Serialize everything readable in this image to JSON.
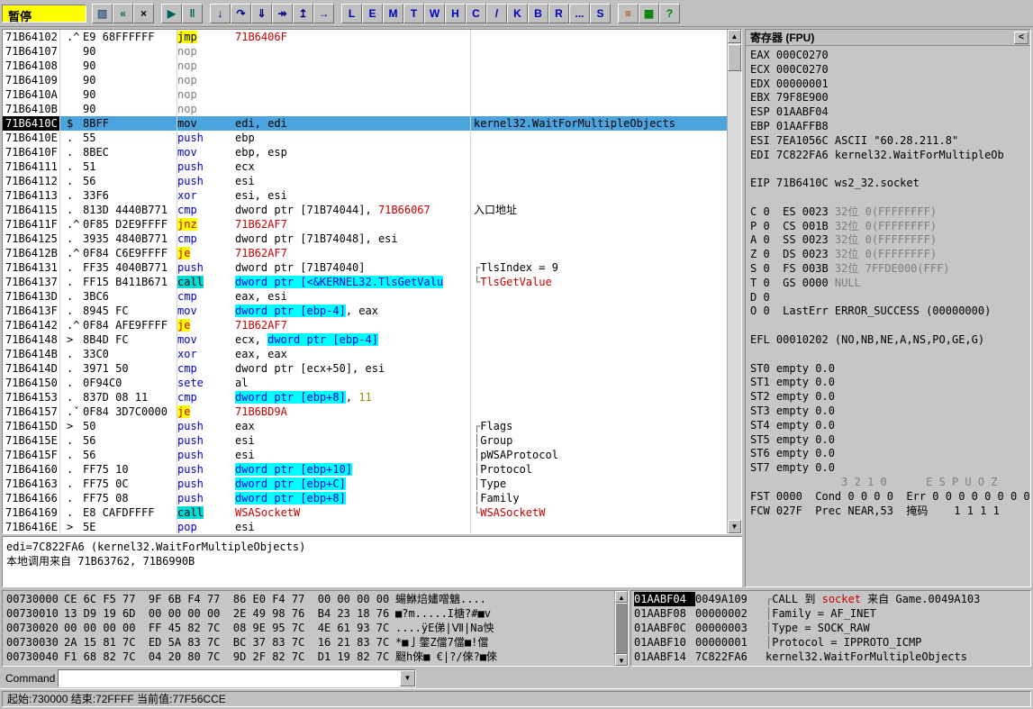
{
  "toolbar": {
    "status": "暂停",
    "groups": [
      [
        {
          "name": "open-file-button",
          "glyph": "▨",
          "color": "#406080"
        },
        {
          "name": "restart-button",
          "glyph": "«",
          "color": "#006060"
        },
        {
          "name": "close-program-button",
          "glyph": "×",
          "color": "#000000"
        }
      ],
      [
        {
          "name": "run-button",
          "glyph": "▶",
          "color": "#006060"
        },
        {
          "name": "pause-button",
          "glyph": "‖",
          "color": "#006060"
        }
      ],
      [
        {
          "name": "step-into-button",
          "glyph": "↓",
          "color": "#000080"
        },
        {
          "name": "step-over-button",
          "glyph": "↷",
          "color": "#000080"
        },
        {
          "name": "animate-into-button",
          "glyph": "⇓",
          "color": "#000080"
        },
        {
          "name": "animate-over-button",
          "glyph": "↠",
          "color": "#000080"
        },
        {
          "name": "execute-till-return-button",
          "glyph": "↥",
          "color": "#000080"
        },
        {
          "name": "goto-address-button",
          "glyph": "→",
          "color": "#000080"
        }
      ],
      [
        {
          "name": "log-window-button",
          "glyph": "L",
          "color": "#0000C0"
        },
        {
          "name": "executables-window-button",
          "glyph": "E",
          "color": "#0000C0"
        },
        {
          "name": "memory-window-button",
          "glyph": "M",
          "color": "#0000C0"
        },
        {
          "name": "threads-window-button",
          "glyph": "T",
          "color": "#0000C0"
        },
        {
          "name": "windows-window-button",
          "glyph": "W",
          "color": "#0000C0"
        },
        {
          "name": "handles-window-button",
          "glyph": "H",
          "color": "#0000C0"
        },
        {
          "name": "cpu-window-button",
          "glyph": "C",
          "color": "#0000C0"
        },
        {
          "name": "patches-window-button",
          "glyph": "/",
          "color": "#0000C0"
        },
        {
          "name": "call-stack-window-button",
          "glyph": "K",
          "color": "#0000C0"
        },
        {
          "name": "breakpoints-window-button",
          "glyph": "B",
          "color": "#0000C0"
        },
        {
          "name": "references-window-button",
          "glyph": "R",
          "color": "#0000C0"
        },
        {
          "name": "run-trace-window-button",
          "glyph": "...",
          "color": "#0000C0"
        },
        {
          "name": "source-window-button",
          "glyph": "S",
          "color": "#0000C0"
        }
      ],
      [
        {
          "name": "options-button",
          "glyph": "≡",
          "color": "#A04000"
        },
        {
          "name": "appearance-button",
          "glyph": "▦",
          "color": "#008000"
        },
        {
          "name": "help-button",
          "glyph": "?",
          "color": "#008000"
        }
      ]
    ]
  },
  "disasm": {
    "rows": [
      {
        "addr": "71B64102",
        "mark": ".^",
        "hex": "E9 68FFFFFF",
        "mn": [
          "jmp",
          "j"
        ],
        "ops": [
          [
            "71B6406F",
            "a"
          ]
        ],
        "cmt": []
      },
      {
        "addr": "71B64107",
        "mark": "",
        "hex": "90",
        "mn": [
          "nop",
          "g"
        ],
        "ops": [],
        "cmt": []
      },
      {
        "addr": "71B64108",
        "mark": "",
        "hex": "90",
        "mn": [
          "nop",
          "g"
        ],
        "ops": [],
        "cmt": []
      },
      {
        "addr": "71B64109",
        "mark": "",
        "hex": "90",
        "mn": [
          "nop",
          "g"
        ],
        "ops": [],
        "cmt": []
      },
      {
        "addr": "71B6410A",
        "mark": "",
        "hex": "90",
        "mn": [
          "nop",
          "g"
        ],
        "ops": [],
        "cmt": []
      },
      {
        "addr": "71B6410B",
        "mark": "",
        "hex": "90",
        "mn": [
          "nop",
          "g"
        ],
        "ops": [],
        "cmt": []
      },
      {
        "addr": "71B6410C",
        "mark": "$",
        "hex": "8BFF",
        "mn": [
          "mov",
          "m"
        ],
        "ops": [
          [
            "edi, edi",
            "k"
          ]
        ],
        "cmt": [
          [
            "kernel32.WaitForMultipleObjects",
            "k"
          ]
        ],
        "sel": true
      },
      {
        "addr": "71B6410E",
        "mark": ".",
        "hex": "55",
        "mn": [
          "push",
          "m"
        ],
        "ops": [
          [
            "ebp",
            "k"
          ]
        ],
        "cmt": []
      },
      {
        "addr": "71B6410F",
        "mark": ".",
        "hex": "8BEC",
        "mn": [
          "mov",
          "m"
        ],
        "ops": [
          [
            "ebp, esp",
            "k"
          ]
        ],
        "cmt": []
      },
      {
        "addr": "71B64111",
        "mark": ".",
        "hex": "51",
        "mn": [
          "push",
          "m"
        ],
        "ops": [
          [
            "ecx",
            "k"
          ]
        ],
        "cmt": []
      },
      {
        "addr": "71B64112",
        "mark": ".",
        "hex": "56",
        "mn": [
          "push",
          "m"
        ],
        "ops": [
          [
            "esi",
            "k"
          ]
        ],
        "cmt": []
      },
      {
        "addr": "71B64113",
        "mark": ".",
        "hex": "33F6",
        "mn": [
          "xor",
          "m"
        ],
        "ops": [
          [
            "esi, esi",
            "k"
          ]
        ],
        "cmt": []
      },
      {
        "addr": "71B64115",
        "mark": ".",
        "hex": "813D 4440B771",
        "mn": [
          "cmp",
          "m"
        ],
        "ops": [
          [
            "dword ptr [71B74044], ",
            "k"
          ],
          [
            "71B66067",
            "a"
          ]
        ],
        "cmt": [
          [
            "入口地址",
            "k"
          ]
        ]
      },
      {
        "addr": "71B6411F",
        "mark": ".^",
        "hex": "0F85 D2E9FFFF",
        "mn": [
          "jnz",
          "cj"
        ],
        "ops": [
          [
            "71B62AF7",
            "a"
          ]
        ],
        "cmt": []
      },
      {
        "addr": "71B64125",
        "mark": ".",
        "hex": "3935 4840B771",
        "mn": [
          "cmp",
          "m"
        ],
        "ops": [
          [
            "dword ptr [71B74048], esi",
            "k"
          ]
        ],
        "cmt": []
      },
      {
        "addr": "71B6412B",
        "mark": ".^",
        "hex": "0F84 C6E9FFFF",
        "mn": [
          "je",
          "cj"
        ],
        "ops": [
          [
            "71B62AF7",
            "a"
          ]
        ],
        "cmt": []
      },
      {
        "addr": "71B64131",
        "mark": ".",
        "hex": "FF35 4040B771",
        "mn": [
          "push",
          "m"
        ],
        "ops": [
          [
            "dword ptr [71B74040]",
            "k"
          ]
        ],
        "cmt": [
          [
            "┌",
            "br"
          ],
          [
            "TlsIndex = 9",
            "k"
          ]
        ]
      },
      {
        "addr": "71B64137",
        "mark": ".",
        "hex": "FF15 B411B671",
        "mn": [
          "call",
          "c"
        ],
        "ops": [
          [
            "dword ptr [<&KERNEL32.TlsGetValu",
            "h"
          ]
        ],
        "cmt": [
          [
            "└",
            "br"
          ],
          [
            "TlsGetValue",
            "r"
          ]
        ]
      },
      {
        "addr": "71B6413D",
        "mark": ".",
        "hex": "3BC6",
        "mn": [
          "cmp",
          "m"
        ],
        "ops": [
          [
            "eax, esi",
            "k"
          ]
        ],
        "cmt": []
      },
      {
        "addr": "71B6413F",
        "mark": ".",
        "hex": "8945 FC",
        "mn": [
          "mov",
          "m"
        ],
        "ops": [
          [
            "dword ptr [ebp-4]",
            "h"
          ],
          [
            ", eax",
            "k"
          ]
        ],
        "cmt": []
      },
      {
        "addr": "71B64142",
        "mark": ".^",
        "hex": "0F84 AFE9FFFF",
        "mn": [
          "je",
          "cj"
        ],
        "ops": [
          [
            "71B62AF7",
            "a"
          ]
        ],
        "cmt": []
      },
      {
        "addr": "71B64148",
        "mark": ">",
        "hex": "8B4D FC",
        "mn": [
          "mov",
          "m"
        ],
        "ops": [
          [
            "ecx, ",
            "k"
          ],
          [
            "dword ptr [ebp-4]",
            "h"
          ]
        ],
        "cmt": []
      },
      {
        "addr": "71B6414B",
        "mark": ".",
        "hex": "33C0",
        "mn": [
          "xor",
          "m"
        ],
        "ops": [
          [
            "eax, eax",
            "k"
          ]
        ],
        "cmt": []
      },
      {
        "addr": "71B6414D",
        "mark": ".",
        "hex": "3971 50",
        "mn": [
          "cmp",
          "m"
        ],
        "ops": [
          [
            "dword ptr [ecx+50], esi",
            "k"
          ]
        ],
        "cmt": []
      },
      {
        "addr": "71B64150",
        "mark": ".",
        "hex": "0F94C0",
        "mn": [
          "sete",
          "m"
        ],
        "ops": [
          [
            "al",
            "k"
          ]
        ],
        "cmt": []
      },
      {
        "addr": "71B64153",
        "mark": ".",
        "hex": "837D 08 11",
        "mn": [
          "cmp",
          "m"
        ],
        "ops": [
          [
            "dword ptr [ebp+8]",
            "h"
          ],
          [
            ", ",
            "k"
          ],
          [
            "11",
            "o"
          ]
        ],
        "cmt": []
      },
      {
        "addr": "71B64157",
        "mark": ".ˇ",
        "hex": "0F84 3D7C0000",
        "mn": [
          "je",
          "cj"
        ],
        "ops": [
          [
            "71B6BD9A",
            "a"
          ]
        ],
        "cmt": []
      },
      {
        "addr": "71B6415D",
        "mark": ">",
        "hex": "50",
        "mn": [
          "push",
          "m"
        ],
        "ops": [
          [
            "eax",
            "k"
          ]
        ],
        "cmt": [
          [
            "┌",
            "br"
          ],
          [
            "Flags",
            "k"
          ]
        ]
      },
      {
        "addr": "71B6415E",
        "mark": ".",
        "hex": "56",
        "mn": [
          "push",
          "m"
        ],
        "ops": [
          [
            "esi",
            "k"
          ]
        ],
        "cmt": [
          [
            "│",
            "br"
          ],
          [
            "Group",
            "k"
          ]
        ]
      },
      {
        "addr": "71B6415F",
        "mark": ".",
        "hex": "56",
        "mn": [
          "push",
          "m"
        ],
        "ops": [
          [
            "esi",
            "k"
          ]
        ],
        "cmt": [
          [
            "│",
            "br"
          ],
          [
            "pWSAProtocol",
            "k"
          ]
        ]
      },
      {
        "addr": "71B64160",
        "mark": ".",
        "hex": "FF75 10",
        "mn": [
          "push",
          "m"
        ],
        "ops": [
          [
            "dword ptr [ebp+10]",
            "h"
          ]
        ],
        "cmt": [
          [
            "│",
            "br"
          ],
          [
            "Protocol",
            "k"
          ]
        ]
      },
      {
        "addr": "71B64163",
        "mark": ".",
        "hex": "FF75 0C",
        "mn": [
          "push",
          "m"
        ],
        "ops": [
          [
            "dword ptr [ebp+C]",
            "h"
          ]
        ],
        "cmt": [
          [
            "│",
            "br"
          ],
          [
            "Type",
            "k"
          ]
        ]
      },
      {
        "addr": "71B64166",
        "mark": ".",
        "hex": "FF75 08",
        "mn": [
          "push",
          "m"
        ],
        "ops": [
          [
            "dword ptr [ebp+8]",
            "h"
          ]
        ],
        "cmt": [
          [
            "│",
            "br"
          ],
          [
            "Family",
            "k"
          ]
        ]
      },
      {
        "addr": "71B64169",
        "mark": ".",
        "hex": "E8 CAFDFFFF",
        "mn": [
          "call",
          "c"
        ],
        "ops": [
          [
            "WSASocketW",
            "a"
          ]
        ],
        "cmt": [
          [
            "└",
            "br"
          ],
          [
            "WSASocketW",
            "r"
          ]
        ]
      },
      {
        "addr": "71B6416E",
        "mark": ">",
        "hex": "5E",
        "mn": [
          "pop",
          "m"
        ],
        "ops": [
          [
            "esi",
            "k"
          ]
        ],
        "cmt": []
      }
    ]
  },
  "info_pane": {
    "line1": "edi=7C822FA6 (kernel32.WaitForMultipleObjects)",
    "line2": "本地调用来自 71B63762, 71B6990B"
  },
  "registers": {
    "title": "寄存器 (FPU)",
    "collapse_label": "<",
    "lines": [
      [
        [
          "EAX 000C0270",
          "k"
        ]
      ],
      [
        [
          "ECX 000C0270",
          "k"
        ]
      ],
      [
        [
          "EDX 00000001",
          "k"
        ]
      ],
      [
        [
          "EBX 79F8E900",
          "k"
        ]
      ],
      [
        [
          "ESP 01AABF04",
          "k"
        ]
      ],
      [
        [
          "EBP 01AAFFB8",
          "k"
        ]
      ],
      [
        [
          "ESI 7EA1056C ASCII \"60.28.211.8\"",
          "k"
        ]
      ],
      [
        [
          "EDI 7C822FA6 kernel32.WaitForMultipleOb",
          "k"
        ]
      ],
      [],
      [
        [
          "EIP 71B6410C ws2_32.socket",
          "k"
        ]
      ],
      [],
      [
        [
          "C 0  ES 0023 ",
          "k"
        ],
        [
          "32位 0(FFFFFFFF)",
          "g"
        ]
      ],
      [
        [
          "P 0  CS 001B ",
          "k"
        ],
        [
          "32位 0(FFFFFFFF)",
          "g"
        ]
      ],
      [
        [
          "A 0  SS 0023 ",
          "k"
        ],
        [
          "32位 0(FFFFFFFF)",
          "g"
        ]
      ],
      [
        [
          "Z 0  DS 0023 ",
          "k"
        ],
        [
          "32位 0(FFFFFFFF)",
          "g"
        ]
      ],
      [
        [
          "S 0  FS 003B ",
          "k"
        ],
        [
          "32位 7FFDE000(FFF)",
          "g"
        ]
      ],
      [
        [
          "T 0  GS 0000 ",
          "k"
        ],
        [
          "NULL",
          "g"
        ]
      ],
      [
        [
          "D 0",
          "k"
        ]
      ],
      [
        [
          "O 0  LastErr ERROR_SUCCESS (00000000)",
          "k"
        ]
      ],
      [],
      [
        [
          "EFL 00010202 (NO,NB,NE,A,NS,PO,GE,G)",
          "k"
        ]
      ],
      [],
      [
        [
          "ST0 empty 0.0",
          "k"
        ]
      ],
      [
        [
          "ST1 empty 0.0",
          "k"
        ]
      ],
      [
        [
          "ST2 empty 0.0",
          "k"
        ]
      ],
      [
        [
          "ST3 empty 0.0",
          "k"
        ]
      ],
      [
        [
          "ST4 empty 0.0",
          "k"
        ]
      ],
      [
        [
          "ST5 empty 0.0",
          "k"
        ]
      ],
      [
        [
          "ST6 empty 0.0",
          "k"
        ]
      ],
      [
        [
          "ST7 empty 0.0",
          "k"
        ]
      ],
      [
        [
          "              3 2 1 0      E S P U O Z",
          "g"
        ]
      ],
      [
        [
          "FST 0000  Cond 0 0 0 0  Err 0 0 0 0 0 0 0 0",
          "k"
        ]
      ],
      [
        [
          "FCW 027F  Prec NEAR,53  掩码    1 1 1 1",
          "k"
        ]
      ]
    ]
  },
  "dump": {
    "rows": [
      {
        "addr": "00730000",
        "hex": "CE 6C F5 77  9F 6B F4 77  86 E0 F4 77  00 00 00 00",
        "text": "蝪鮴焙嫿噌魑...."
      },
      {
        "addr": "00730010",
        "hex": "13 D9 19 6D  00 00 00 00  2E 49 98 76  B4 23 18 76",
        "text": "■?m.....I榶?#■v"
      },
      {
        "addr": "00730020",
        "hex": "00 00 00 00  FF 45 82 7C  08 9E 95 7C  4E 61 93 7C",
        "text": "....ÿE俤|Ⅶ|Na怏"
      },
      {
        "addr": "00730030",
        "hex": "2A 15 81 7C  ED 5A 83 7C  BC 37 83 7C  16 21 83 7C",
        "text": "*■亅鐅Z儅7儅■!儅"
      },
      {
        "addr": "00730040",
        "hex": "F1 68 82 7C  04 20 80 7C  9D 2F 82 7C  D1 19 82 7C",
        "text": "颬h倈■ €|?/倈?■倈"
      }
    ]
  },
  "stack": {
    "rows": [
      {
        "addr": "01AABF04",
        "sel": true,
        "val": "0049A109",
        "cmt": [
          [
            "┌",
            "br"
          ],
          [
            "CALL 到 ",
            "k"
          ],
          [
            "socket",
            "r"
          ],
          [
            " 来自 Game.0049A103",
            "k"
          ]
        ]
      },
      {
        "addr": "01AABF08",
        "val": "00000002",
        "cmt": [
          [
            "│",
            "br"
          ],
          [
            "Family = AF_INET",
            "k"
          ]
        ]
      },
      {
        "addr": "01AABF0C",
        "val": "00000003",
        "cmt": [
          [
            "│",
            "br"
          ],
          [
            "Type = SOCK_RAW",
            "k"
          ]
        ]
      },
      {
        "addr": "01AABF10",
        "val": "00000001",
        "cmt": [
          [
            "│",
            "br"
          ],
          [
            "Protocol = IPPROTO_ICMP",
            "k"
          ]
        ]
      },
      {
        "addr": "01AABF14",
        "val": "7C822FA6",
        "cmt": [
          [
            "kernel32.WaitForMultipleObjects",
            "k"
          ]
        ]
      }
    ]
  },
  "command_bar": {
    "label": "Command",
    "value": ""
  },
  "status_bar": {
    "text": "起始:730000 结束:72FFFF 当前值:77F56CCE"
  }
}
